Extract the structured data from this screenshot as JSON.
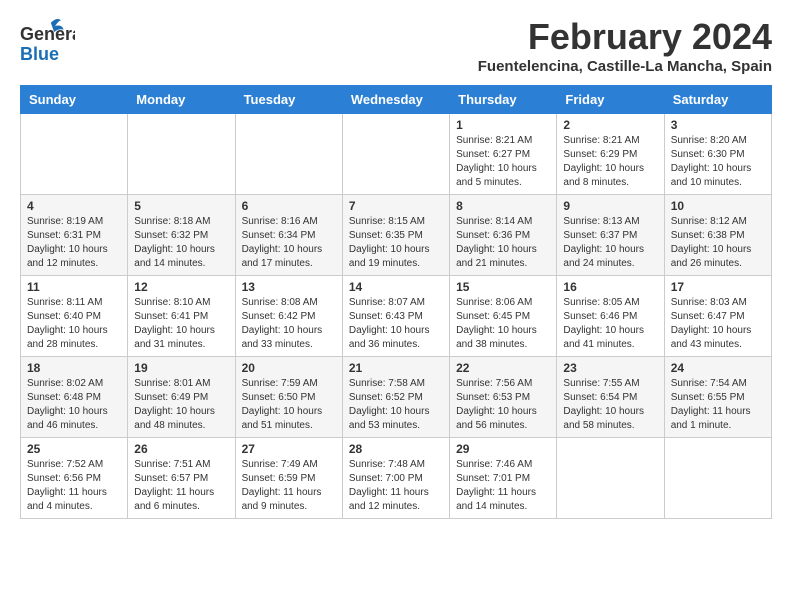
{
  "header": {
    "logo_general": "General",
    "logo_blue": "Blue",
    "month_title": "February 2024",
    "location": "Fuentelencina, Castille-La Mancha, Spain"
  },
  "weekdays": [
    "Sunday",
    "Monday",
    "Tuesday",
    "Wednesday",
    "Thursday",
    "Friday",
    "Saturday"
  ],
  "weeks": [
    [
      {
        "day": "",
        "sunrise": "",
        "sunset": "",
        "daylight": ""
      },
      {
        "day": "",
        "sunrise": "",
        "sunset": "",
        "daylight": ""
      },
      {
        "day": "",
        "sunrise": "",
        "sunset": "",
        "daylight": ""
      },
      {
        "day": "",
        "sunrise": "",
        "sunset": "",
        "daylight": ""
      },
      {
        "day": "1",
        "sunrise": "Sunrise: 8:21 AM",
        "sunset": "Sunset: 6:27 PM",
        "daylight": "Daylight: 10 hours and 5 minutes."
      },
      {
        "day": "2",
        "sunrise": "Sunrise: 8:21 AM",
        "sunset": "Sunset: 6:29 PM",
        "daylight": "Daylight: 10 hours and 8 minutes."
      },
      {
        "day": "3",
        "sunrise": "Sunrise: 8:20 AM",
        "sunset": "Sunset: 6:30 PM",
        "daylight": "Daylight: 10 hours and 10 minutes."
      }
    ],
    [
      {
        "day": "4",
        "sunrise": "Sunrise: 8:19 AM",
        "sunset": "Sunset: 6:31 PM",
        "daylight": "Daylight: 10 hours and 12 minutes."
      },
      {
        "day": "5",
        "sunrise": "Sunrise: 8:18 AM",
        "sunset": "Sunset: 6:32 PM",
        "daylight": "Daylight: 10 hours and 14 minutes."
      },
      {
        "day": "6",
        "sunrise": "Sunrise: 8:16 AM",
        "sunset": "Sunset: 6:34 PM",
        "daylight": "Daylight: 10 hours and 17 minutes."
      },
      {
        "day": "7",
        "sunrise": "Sunrise: 8:15 AM",
        "sunset": "Sunset: 6:35 PM",
        "daylight": "Daylight: 10 hours and 19 minutes."
      },
      {
        "day": "8",
        "sunrise": "Sunrise: 8:14 AM",
        "sunset": "Sunset: 6:36 PM",
        "daylight": "Daylight: 10 hours and 21 minutes."
      },
      {
        "day": "9",
        "sunrise": "Sunrise: 8:13 AM",
        "sunset": "Sunset: 6:37 PM",
        "daylight": "Daylight: 10 hours and 24 minutes."
      },
      {
        "day": "10",
        "sunrise": "Sunrise: 8:12 AM",
        "sunset": "Sunset: 6:38 PM",
        "daylight": "Daylight: 10 hours and 26 minutes."
      }
    ],
    [
      {
        "day": "11",
        "sunrise": "Sunrise: 8:11 AM",
        "sunset": "Sunset: 6:40 PM",
        "daylight": "Daylight: 10 hours and 28 minutes."
      },
      {
        "day": "12",
        "sunrise": "Sunrise: 8:10 AM",
        "sunset": "Sunset: 6:41 PM",
        "daylight": "Daylight: 10 hours and 31 minutes."
      },
      {
        "day": "13",
        "sunrise": "Sunrise: 8:08 AM",
        "sunset": "Sunset: 6:42 PM",
        "daylight": "Daylight: 10 hours and 33 minutes."
      },
      {
        "day": "14",
        "sunrise": "Sunrise: 8:07 AM",
        "sunset": "Sunset: 6:43 PM",
        "daylight": "Daylight: 10 hours and 36 minutes."
      },
      {
        "day": "15",
        "sunrise": "Sunrise: 8:06 AM",
        "sunset": "Sunset: 6:45 PM",
        "daylight": "Daylight: 10 hours and 38 minutes."
      },
      {
        "day": "16",
        "sunrise": "Sunrise: 8:05 AM",
        "sunset": "Sunset: 6:46 PM",
        "daylight": "Daylight: 10 hours and 41 minutes."
      },
      {
        "day": "17",
        "sunrise": "Sunrise: 8:03 AM",
        "sunset": "Sunset: 6:47 PM",
        "daylight": "Daylight: 10 hours and 43 minutes."
      }
    ],
    [
      {
        "day": "18",
        "sunrise": "Sunrise: 8:02 AM",
        "sunset": "Sunset: 6:48 PM",
        "daylight": "Daylight: 10 hours and 46 minutes."
      },
      {
        "day": "19",
        "sunrise": "Sunrise: 8:01 AM",
        "sunset": "Sunset: 6:49 PM",
        "daylight": "Daylight: 10 hours and 48 minutes."
      },
      {
        "day": "20",
        "sunrise": "Sunrise: 7:59 AM",
        "sunset": "Sunset: 6:50 PM",
        "daylight": "Daylight: 10 hours and 51 minutes."
      },
      {
        "day": "21",
        "sunrise": "Sunrise: 7:58 AM",
        "sunset": "Sunset: 6:52 PM",
        "daylight": "Daylight: 10 hours and 53 minutes."
      },
      {
        "day": "22",
        "sunrise": "Sunrise: 7:56 AM",
        "sunset": "Sunset: 6:53 PM",
        "daylight": "Daylight: 10 hours and 56 minutes."
      },
      {
        "day": "23",
        "sunrise": "Sunrise: 7:55 AM",
        "sunset": "Sunset: 6:54 PM",
        "daylight": "Daylight: 10 hours and 58 minutes."
      },
      {
        "day": "24",
        "sunrise": "Sunrise: 7:54 AM",
        "sunset": "Sunset: 6:55 PM",
        "daylight": "Daylight: 11 hours and 1 minute."
      }
    ],
    [
      {
        "day": "25",
        "sunrise": "Sunrise: 7:52 AM",
        "sunset": "Sunset: 6:56 PM",
        "daylight": "Daylight: 11 hours and 4 minutes."
      },
      {
        "day": "26",
        "sunrise": "Sunrise: 7:51 AM",
        "sunset": "Sunset: 6:57 PM",
        "daylight": "Daylight: 11 hours and 6 minutes."
      },
      {
        "day": "27",
        "sunrise": "Sunrise: 7:49 AM",
        "sunset": "Sunset: 6:59 PM",
        "daylight": "Daylight: 11 hours and 9 minutes."
      },
      {
        "day": "28",
        "sunrise": "Sunrise: 7:48 AM",
        "sunset": "Sunset: 7:00 PM",
        "daylight": "Daylight: 11 hours and 12 minutes."
      },
      {
        "day": "29",
        "sunrise": "Sunrise: 7:46 AM",
        "sunset": "Sunset: 7:01 PM",
        "daylight": "Daylight: 11 hours and 14 minutes."
      },
      {
        "day": "",
        "sunrise": "",
        "sunset": "",
        "daylight": ""
      },
      {
        "day": "",
        "sunrise": "",
        "sunset": "",
        "daylight": ""
      }
    ]
  ]
}
